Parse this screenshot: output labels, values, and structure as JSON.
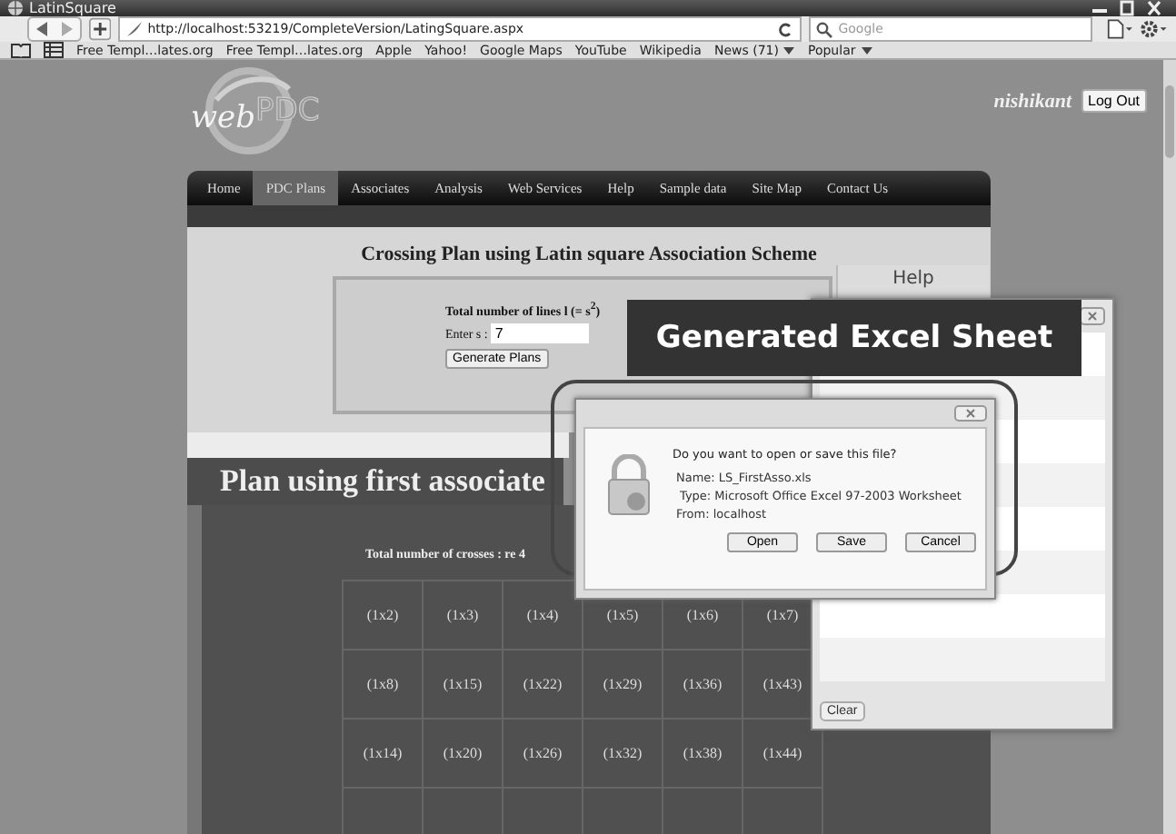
{
  "window": {
    "title": "LatinSquare"
  },
  "toolbar": {
    "url": "http://localhost:53219/CompleteVersion/LatingSquare.aspx",
    "search_placeholder": "Google"
  },
  "bookmarks": [
    {
      "label": "Free Templ…lates.org",
      "menu": false
    },
    {
      "label": "Free Templ…lates.org",
      "menu": false
    },
    {
      "label": "Apple",
      "menu": false
    },
    {
      "label": "Yahoo!",
      "menu": false
    },
    {
      "label": "Google Maps",
      "menu": false
    },
    {
      "label": "YouTube",
      "menu": false
    },
    {
      "label": "Wikipedia",
      "menu": false
    },
    {
      "label": "News (71)",
      "menu": true
    },
    {
      "label": "Popular",
      "menu": true
    }
  ],
  "site": {
    "logo_prefix": "web",
    "logo_suffix": "PDC",
    "user": "nishikant",
    "logout": "Log Out"
  },
  "nav": [
    {
      "label": "Home",
      "selected": false
    },
    {
      "label": "PDC Plans",
      "selected": true
    },
    {
      "label": "Associates",
      "selected": false
    },
    {
      "label": "Analysis",
      "selected": false
    },
    {
      "label": "Web Services",
      "selected": false
    },
    {
      "label": "Help",
      "selected": false
    },
    {
      "label": "Sample data",
      "selected": false
    },
    {
      "label": "Site Map",
      "selected": false
    },
    {
      "label": "Contact Us",
      "selected": false
    }
  ],
  "form": {
    "title": "Crossing Plan using Latin square Association Scheme",
    "lines_label": "Total number of lines l (= s$^{2}$)",
    "s_label": "Enter s :",
    "s_value": "7",
    "button": "Generate Plans",
    "help": "Help"
  },
  "plan": {
    "heading": "Plan using first associate",
    "total": "Total number of crosses : re 4",
    "rows": [
      [
        "(1x2)",
        "(1x3)",
        "(1x4)",
        "(1x5)",
        "(1x6)",
        "(1x7)"
      ],
      [
        "(1x8)",
        "(1x15)",
        "(1x22)",
        "(1x29)",
        "(1x36)",
        "(1x43)"
      ],
      [
        "(1x14)",
        "(1x20)",
        "(1x26)",
        "(1x32)",
        "(1x38)",
        "(1x44)"
      ]
    ]
  },
  "downloads": {
    "button": "Clear"
  },
  "callout": "Generated Excel Sheet",
  "dialog": {
    "question": "Do you want to open or save this file?",
    "name": "Name: LS_FirstAsso.xls",
    "type": "Type: Microsoft Office Excel 97-2003 Worksheet",
    "from": "From: localhost",
    "buttons": [
      "Open",
      "Save",
      "Cancel"
    ]
  }
}
